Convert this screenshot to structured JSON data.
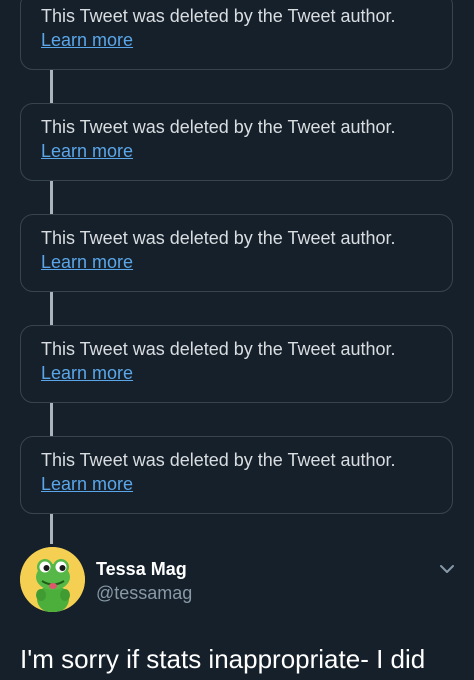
{
  "thread": {
    "deleted_tweets": [
      {
        "message": "This Tweet was deleted by the Tweet author.",
        "link": "Learn more"
      },
      {
        "message": "This Tweet was deleted by the Tweet author.",
        "link": "Learn more"
      },
      {
        "message": "This Tweet was deleted by the Tweet author.",
        "link": "Learn more"
      },
      {
        "message": "This Tweet was deleted by the Tweet author.",
        "link": "Learn more"
      },
      {
        "message": "This Tweet was deleted by the Tweet author.",
        "link": "Learn more"
      }
    ]
  },
  "tweet": {
    "author_name": "Tessa Mag",
    "author_handle": "@tessamag",
    "text": "I'm sorry if stats inappropriate- I did",
    "avatar_icon": "green-frog-avatar",
    "menu_icon": "chevron-down-icon"
  },
  "colors": {
    "background": "#15202b",
    "card_border": "#38444d",
    "link": "#5aa6e8",
    "muted_text": "#8899a6",
    "avatar_bg": "#f2c94c"
  }
}
